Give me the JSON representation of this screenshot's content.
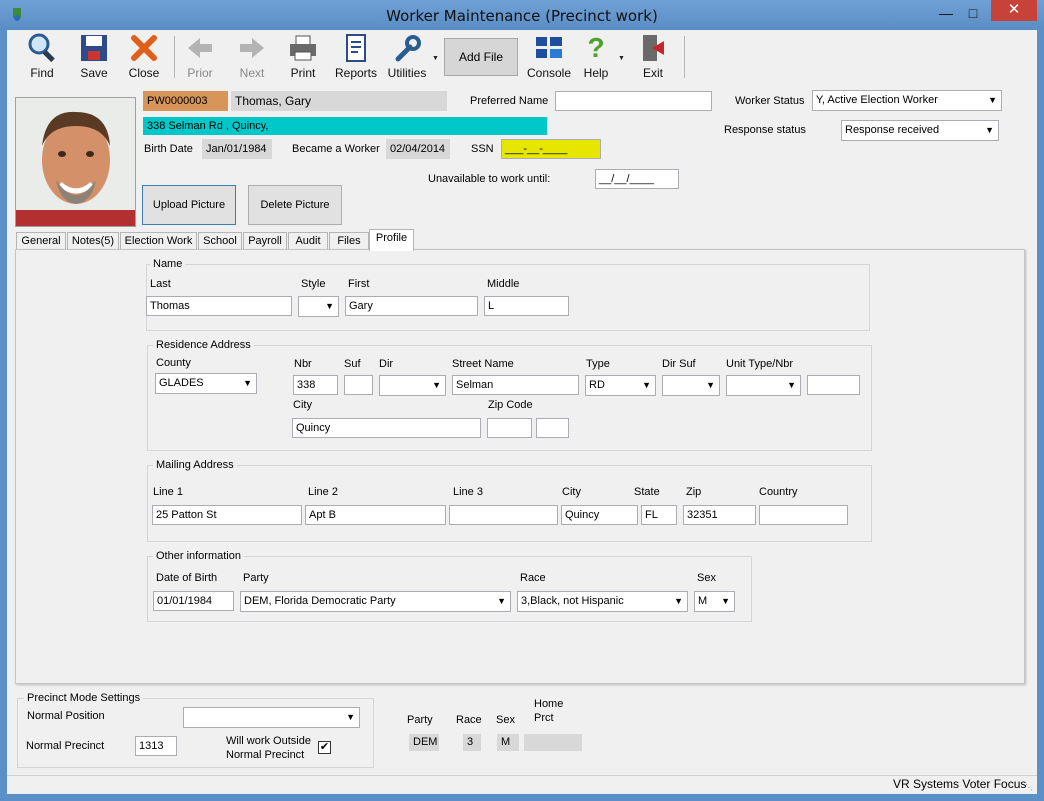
{
  "window": {
    "title": "Worker Maintenance (Precinct work)"
  },
  "toolbar": {
    "find": "Find",
    "save": "Save",
    "close": "Close",
    "prior": "Prior",
    "next": "Next",
    "print": "Print",
    "reports": "Reports",
    "utilities": "Utilities",
    "add_file": "Add File",
    "console": "Console",
    "help": "Help",
    "exit": "Exit"
  },
  "worker": {
    "id": "PW0000003",
    "name": "Thomas, Gary",
    "address": "338 Selman Rd , Quincy,",
    "birth_date_label": "Birth Date",
    "birth_date": "Jan/01/1984",
    "became_worker_label": "Became a Worker",
    "became_worker": "02/04/2014",
    "ssn_label": "SSN",
    "ssn": "___-__-____",
    "preferred_name_label": "Preferred Name",
    "preferred_name": "",
    "worker_status_label": "Worker Status",
    "worker_status": "Y, Active Election Worker",
    "response_status_label": "Response status",
    "response_status": "Response received",
    "unavailable_label": "Unavailable to work until:",
    "unavailable": "__/__/____",
    "upload_picture": "Upload Picture",
    "delete_picture": "Delete Picture"
  },
  "tabs": [
    "General",
    "Notes(5)",
    "Election Work",
    "School",
    "Payroll",
    "Audit",
    "Files",
    "Profile"
  ],
  "profile": {
    "name_group": "Name",
    "last_label": "Last",
    "last": "Thomas",
    "style_label": "Style",
    "style": "",
    "first_label": "First",
    "first": "Gary",
    "middle_label": "Middle",
    "middle": "L",
    "residence_group": "Residence Address",
    "county_label": "County",
    "county": "GLADES",
    "nbr_label": "Nbr",
    "nbr": "338",
    "suf_label": "Suf",
    "suf": "",
    "dir_label": "Dir",
    "dir": "",
    "street_label": "Street Name",
    "street": "Selman",
    "type_label": "Type",
    "type": "RD",
    "dirsuf_label": "Dir Suf",
    "dirsuf": "",
    "unit_label": "Unit Type/Nbr",
    "unit_type": "",
    "unit_nbr": "",
    "city_label": "City",
    "city": "Quincy",
    "zip_label": "Zip Code",
    "zip": "",
    "zip4": "",
    "mailing_group": "Mailing Address",
    "line1_label": "Line 1",
    "line1": "25 Patton St",
    "line2_label": "Line 2",
    "line2": "Apt B",
    "line3_label": "Line 3",
    "line3": "",
    "mcity_label": "City",
    "mcity": "Quincy",
    "state_label": "State",
    "state": "FL",
    "mzip_label": "Zip",
    "mzip": "32351",
    "country_label": "Country",
    "country": "",
    "other_group": "Other information",
    "dob_label": "Date of Birth",
    "dob": "01/01/1984",
    "party_label": "Party",
    "party": "DEM, Florida Democratic Party",
    "race_label": "Race",
    "race": "3,Black, not Hispanic",
    "sex_label": "Sex",
    "sex": "M"
  },
  "precinct": {
    "group": "Precinct Mode Settings",
    "normal_position_label": "Normal Position",
    "normal_position": "",
    "normal_precinct_label": "Normal Precinct",
    "normal_precinct": "1313",
    "outside_label_1": "Will work Outside",
    "outside_label_2": "Normal Precinct",
    "outside_checked": true,
    "party_label": "Party",
    "party": "DEM",
    "race_label": "Race",
    "race": "3",
    "sex_label": "Sex",
    "sex": "M",
    "home_prct_label_1": "Home",
    "home_prct_label_2": "Prct",
    "home_prct": ""
  },
  "status": {
    "text": "VR Systems Voter Focus"
  }
}
